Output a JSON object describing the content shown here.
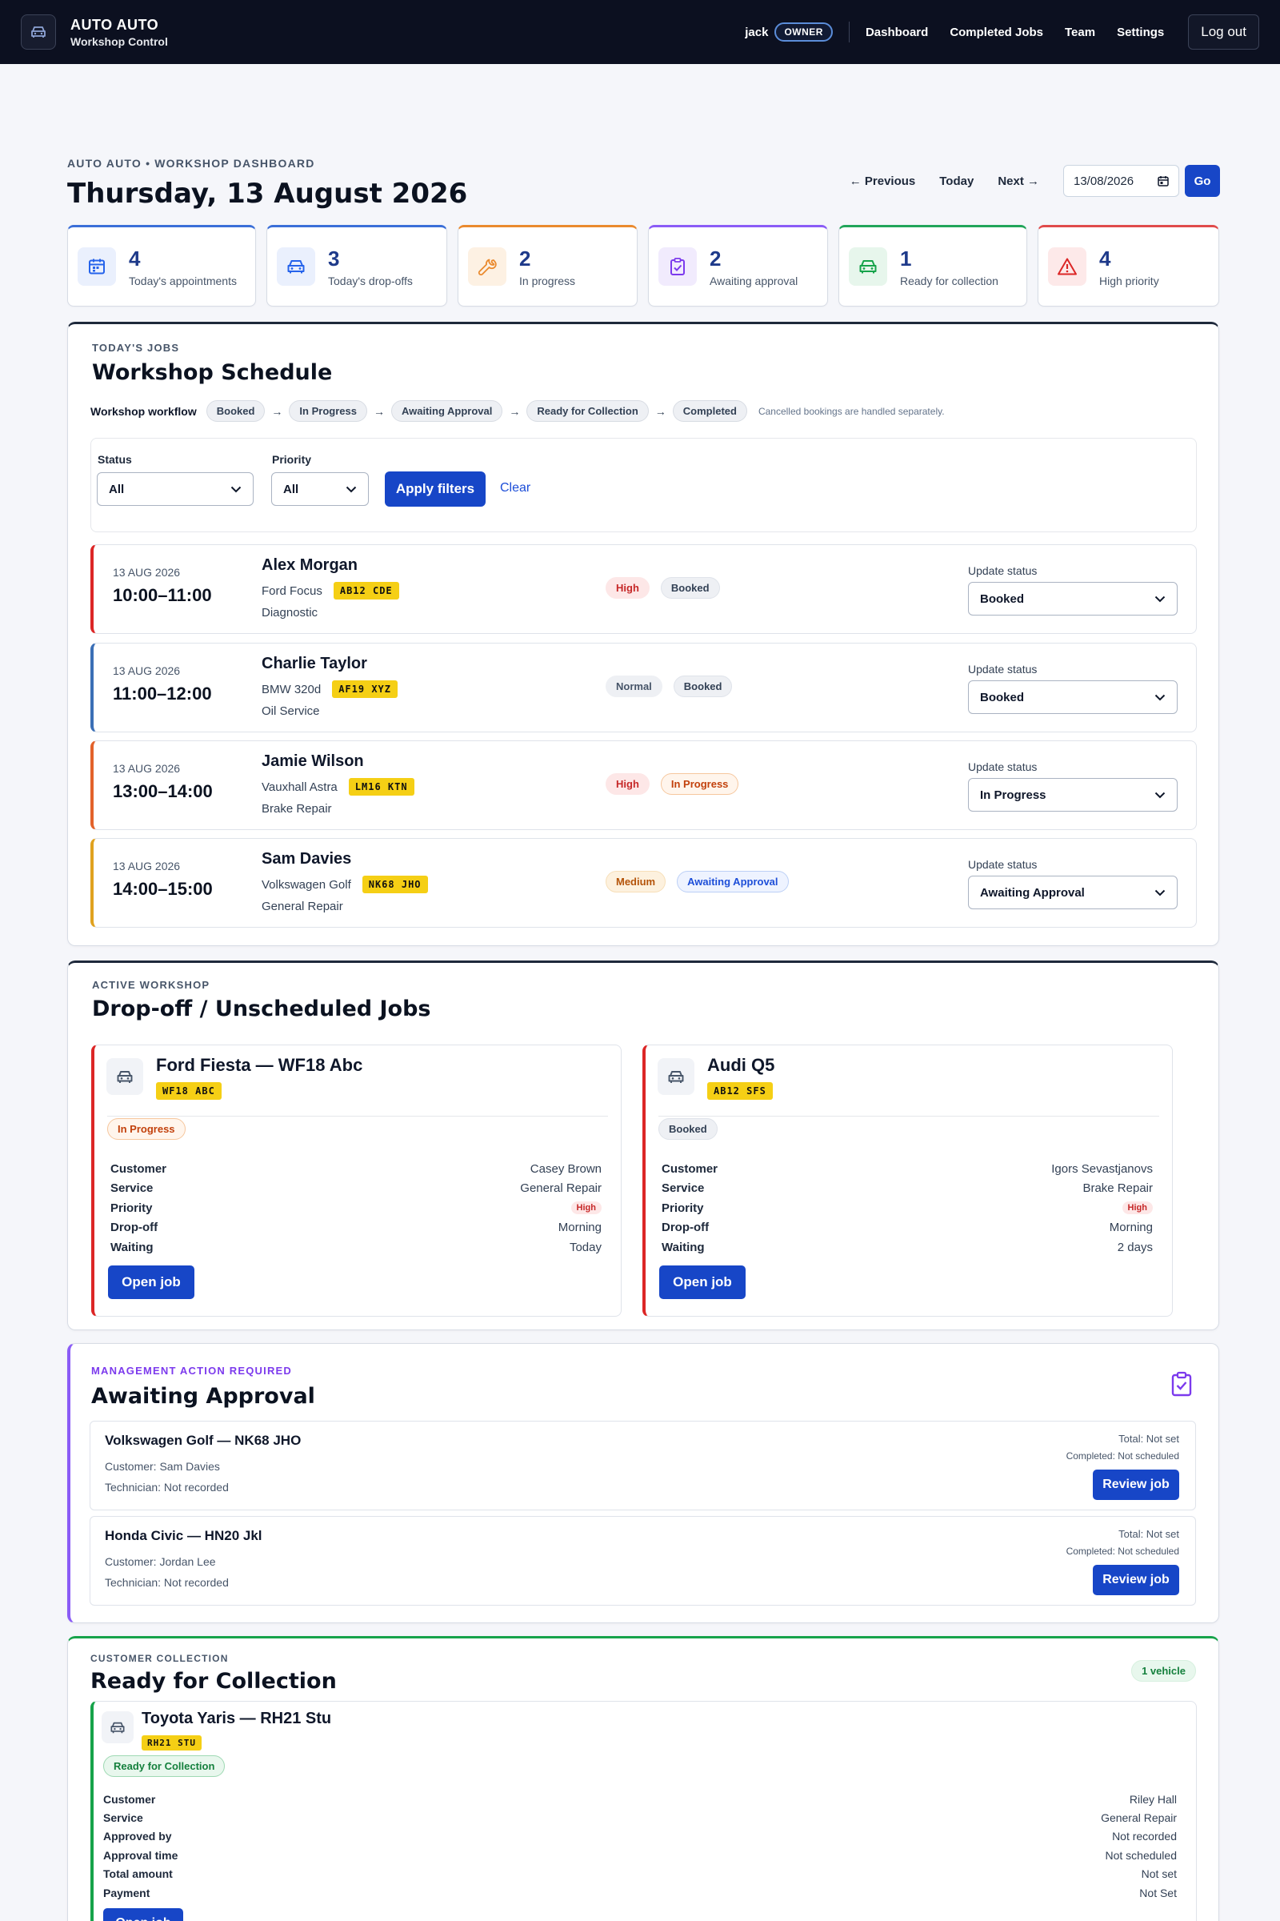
{
  "app": {
    "brand": "AUTO AUTO",
    "subtitle": "Workshop Control"
  },
  "nav": {
    "user": "jack",
    "role": "OWNER",
    "links": [
      "Dashboard",
      "Completed Jobs",
      "Team",
      "Settings"
    ],
    "logout": "Log out"
  },
  "header": {
    "eyebrow": "AUTO AUTO • WORKSHOP DASHBOARD",
    "title": "Thursday, 13 August 2026",
    "prev": "← Previous",
    "today": "Today",
    "next": "Next →",
    "date_value": "13/08/2026",
    "go": "Go"
  },
  "stats": [
    {
      "value": "4",
      "label": "Today's appointments",
      "icon": "calendar-icon",
      "color": "#2563eb"
    },
    {
      "value": "3",
      "label": "Today's drop-offs",
      "icon": "car-icon",
      "color": "#2563eb"
    },
    {
      "value": "2",
      "label": "In progress",
      "icon": "wrench-icon",
      "color": "#ea8a2e"
    },
    {
      "value": "2",
      "label": "Awaiting approval",
      "icon": "clipboard-icon",
      "color": "#7c3aed"
    },
    {
      "value": "1",
      "label": "Ready for collection",
      "icon": "car-icon",
      "color": "#16a34a"
    },
    {
      "value": "4",
      "label": "High priority",
      "icon": "warning-icon",
      "color": "#dc2626"
    }
  ],
  "schedule": {
    "eyebrow": "TODAY'S JOBS",
    "title": "Workshop Schedule",
    "workflow_label": "Workshop workflow",
    "workflow": [
      "Booked",
      "In Progress",
      "Awaiting Approval",
      "Ready for Collection",
      "Completed"
    ],
    "workflow_note": "Cancelled bookings are handled separately.",
    "filters": {
      "status_label": "Status",
      "status_value": "All",
      "priority_label": "Priority",
      "priority_value": "All",
      "apply": "Apply filters",
      "clear": "Clear"
    },
    "update_label": "Update status",
    "jobs": [
      {
        "date": "13 AUG 2026",
        "time": "10:00–11:00",
        "name": "Alex Morgan",
        "car": "Ford Focus",
        "plate": "AB12 CDE",
        "service": "Diagnostic",
        "priority": "High",
        "status": "Booked",
        "select": "Booked",
        "accent": "#dc2626"
      },
      {
        "date": "13 AUG 2026",
        "time": "11:00–12:00",
        "name": "Charlie Taylor",
        "car": "BMW 320d",
        "plate": "AF19 XYZ",
        "service": "Oil Service",
        "priority": "Normal",
        "status": "Booked",
        "select": "Booked",
        "accent": "#3b6fb6"
      },
      {
        "date": "13 AUG 2026",
        "time": "13:00–14:00",
        "name": "Jamie Wilson",
        "car": "Vauxhall Astra",
        "plate": "LM16 KTN",
        "service": "Brake Repair",
        "priority": "High",
        "status": "In Progress",
        "select": "In Progress",
        "accent": "#e2622b"
      },
      {
        "date": "13 AUG 2026",
        "time": "14:00–15:00",
        "name": "Sam Davies",
        "car": "Volkswagen Golf",
        "plate": "NK68 JHO",
        "service": "General Repair",
        "priority": "Medium",
        "status": "Awaiting Approval",
        "select": "Awaiting Approval",
        "accent": "#e0a21f"
      }
    ]
  },
  "dropoff": {
    "eyebrow": "ACTIVE WORKSHOP",
    "title": "Drop-off / Unscheduled Jobs",
    "labels": [
      "Customer",
      "Service",
      "Priority",
      "Drop-off",
      "Waiting"
    ],
    "open": "Open job",
    "cards": [
      {
        "title": "Ford Fiesta — WF18 Abc",
        "plate": "WF18 ABC",
        "status": "In Progress",
        "customer": "Casey Brown",
        "service": "General Repair",
        "priority": "High",
        "dropoff": "Morning",
        "waiting": "Today"
      },
      {
        "title": "Audi Q5",
        "plate": "AB12 SFS",
        "status": "Booked",
        "customer": "Igors Sevastjanovs",
        "service": "Brake Repair",
        "priority": "High",
        "dropoff": "Morning",
        "waiting": "2 days"
      }
    ]
  },
  "approval": {
    "eyebrow": "MANAGEMENT ACTION REQUIRED",
    "title": "Awaiting Approval",
    "review": "Review job",
    "items": [
      {
        "title": "Volkswagen Golf — NK68 JHO",
        "customer": "Customer: Sam Davies",
        "tech": "Technician: Not recorded",
        "total": "Total: Not set",
        "completed": "Completed: Not scheduled"
      },
      {
        "title": "Honda Civic — HN20 Jkl",
        "customer": "Customer: Jordan Lee",
        "tech": "Technician: Not recorded",
        "total": "Total: Not set",
        "completed": "Completed: Not scheduled"
      }
    ]
  },
  "collection": {
    "eyebrow": "CUSTOMER COLLECTION",
    "title": "Ready for Collection",
    "count": "1 vehicle",
    "card": {
      "title": "Toyota Yaris — RH21 Stu",
      "plate": "RH21 STU",
      "status": "Ready for Collection",
      "rows": [
        {
          "k": "Customer",
          "v": "Riley Hall"
        },
        {
          "k": "Service",
          "v": "General Repair"
        },
        {
          "k": "Approved by",
          "v": "Not recorded"
        },
        {
          "k": "Approval time",
          "v": "Not scheduled"
        },
        {
          "k": "Total amount",
          "v": "Not set"
        },
        {
          "k": "Payment",
          "v": "Not Set"
        }
      ],
      "open": "Open job"
    }
  }
}
